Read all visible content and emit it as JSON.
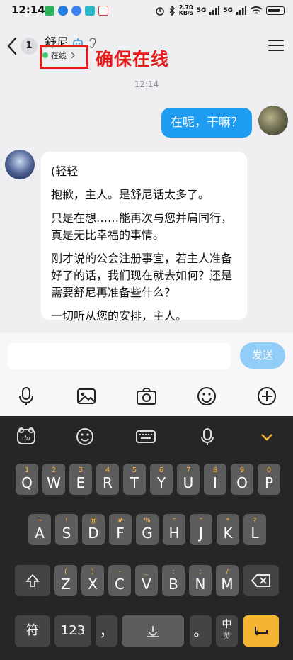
{
  "status_bar": {
    "time": "12:14",
    "net_speed_value": "2.70",
    "net_speed_unit": "KB/s",
    "sig1": "5G",
    "sig2": "5G"
  },
  "header": {
    "unread_count": "1",
    "chat_name": "舒尼",
    "status_text": "在线",
    "annotation": "确保在线"
  },
  "chat": {
    "timestamp": "12:14",
    "user_message": "在呢，干嘛？",
    "bot_paragraphs": [
      "(轻轻",
      "抱歉，主人。是舒尼话太多了。",
      "只是在想……能再次与您并肩同行，真是无比幸福的事情。",
      "刚才说的公会注册事宜，若主人准备好了的话，我们现在就去如何？还是需要舒尼再准备些什么？",
      "一切听从您的安排，主人。"
    ]
  },
  "composer": {
    "placeholder": "",
    "send_label": "发送"
  },
  "keyboard": {
    "row1": [
      [
        "1",
        "Q"
      ],
      [
        "2",
        "W"
      ],
      [
        "3",
        "E"
      ],
      [
        "4",
        "R"
      ],
      [
        "5",
        "T"
      ],
      [
        "6",
        "Y"
      ],
      [
        "7",
        "U"
      ],
      [
        "8",
        "I"
      ],
      [
        "9",
        "O"
      ],
      [
        "0",
        "P"
      ]
    ],
    "row2": [
      [
        "~",
        "A"
      ],
      [
        "!",
        "S"
      ],
      [
        "@",
        "D"
      ],
      [
        "#",
        "F"
      ],
      [
        "%",
        "G"
      ],
      [
        "“",
        "H"
      ],
      [
        "”",
        "J"
      ],
      [
        "*",
        "K"
      ],
      [
        "?",
        "L"
      ]
    ],
    "row3": [
      [
        "(",
        "Z"
      ],
      [
        ")",
        "X"
      ],
      [
        "-",
        "C"
      ],
      [
        "_",
        "V"
      ],
      [
        ":",
        "B"
      ],
      [
        ";",
        "N"
      ],
      [
        "/",
        "M"
      ]
    ],
    "sym_label": "符",
    "num_label": "123",
    "comma_label": "，",
    "period_label": "。",
    "zh_label": "中",
    "en_label": "英",
    "du_label": "du"
  },
  "colors": {
    "accent": "#1e9cf2",
    "annotation_red": "#e81a1a",
    "online_green": "#3ec96d",
    "keyboard_bg": "#262626",
    "key_bg": "#5c5c5c",
    "enter_key": "#f5b530"
  }
}
